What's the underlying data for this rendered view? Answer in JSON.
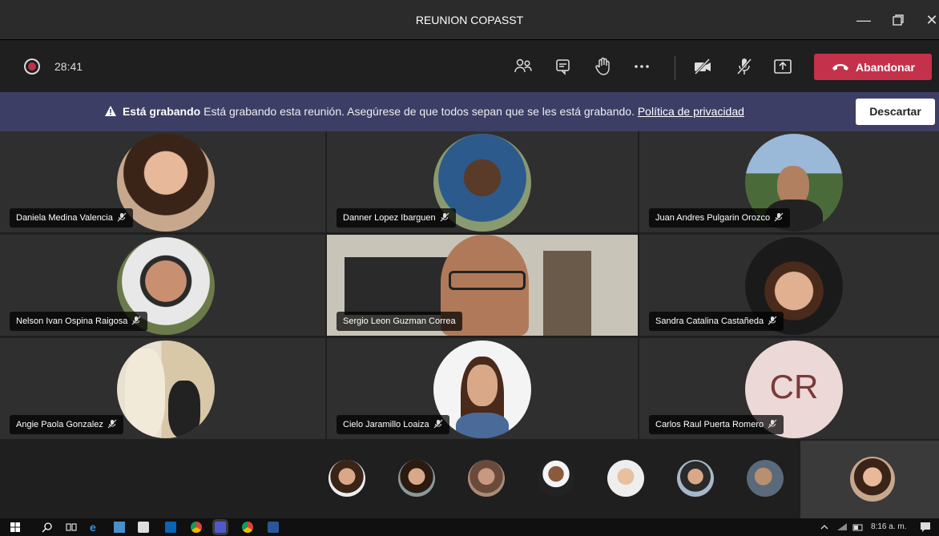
{
  "window": {
    "title": "REUNION COPASST",
    "minimize_icon": "minimize-icon",
    "restore_icon": "restore-icon",
    "close_icon": "close-icon"
  },
  "toolbar": {
    "timer": "28:41",
    "icons": [
      "participants-icon",
      "chat-icon",
      "raise-hand-icon",
      "more-icon",
      "camera-off-icon",
      "mic-off-icon",
      "share-screen-icon"
    ],
    "leave_label": "Abandonar",
    "leave_color": "#c4314b"
  },
  "banner": {
    "title": "Está grabando",
    "message": "Está grabando esta reunión. Asegúrese de que todos sepan que se les está grabando.",
    "link": "Política de privacidad",
    "dismiss": "Descartar",
    "background": "#3d3e66"
  },
  "participants": [
    {
      "name": "Daniela Medina Valencia"
    },
    {
      "name": "Danner Lopez Ibarguen"
    },
    {
      "name": "Juan Andres Pulgarin Orozco"
    },
    {
      "name": "Nelson Ivan Ospina Raigosa"
    },
    {
      "name": "Sergio Leon Guzman Correa"
    },
    {
      "name": "Sandra Catalina Castañeda"
    },
    {
      "name": "Angie Paola Gonzalez"
    },
    {
      "name": "Cielo Jaramillo Loaiza"
    },
    {
      "name": "Carlos Raul Puerta Romero",
      "initials": "CR"
    }
  ],
  "taskbar": {
    "clock": "8:16 a. m."
  }
}
